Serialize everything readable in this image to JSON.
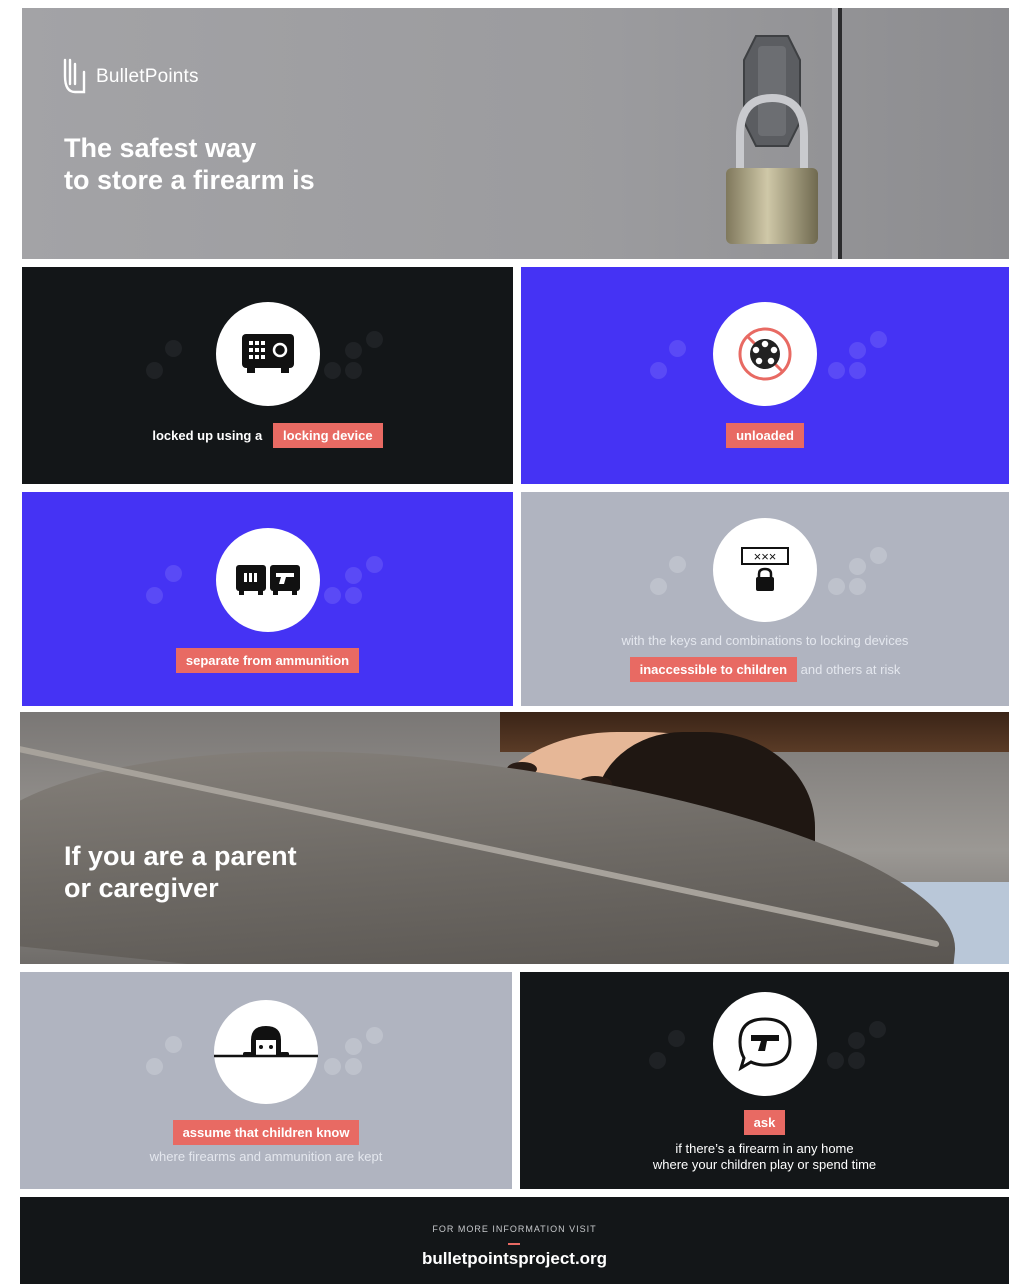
{
  "colors": {
    "coral": "#e86a63",
    "blue": "#4533f4",
    "dark": "#131618",
    "gray": "#b0b4c0",
    "hero_gray": "#9a9a9d"
  },
  "brand": {
    "name": "BulletPoints",
    "logo_icon": "hand-icon"
  },
  "hero": {
    "line1": "The safest way",
    "line2": "to store a firearm is"
  },
  "cards": {
    "locked": {
      "icon": "safe-icon",
      "text": "locked up using a",
      "tag": "locking device"
    },
    "unloaded": {
      "icon": "empty-cylinder-icon",
      "tag": "unloaded"
    },
    "separate": {
      "icon": "separate-safes-icon",
      "tag": "separate from ammunition"
    },
    "inaccessible": {
      "icon": "password-lock-icon",
      "line1": "with the keys and combinations to locking devices",
      "tag": "inaccessible to children",
      "after": "and others at risk"
    }
  },
  "parent": {
    "line1": "If you are a parent",
    "line2": "or caregiver"
  },
  "cards2": {
    "assume": {
      "icon": "peeking-child-icon",
      "tag": "assume that children know",
      "line": "where firearms and ammunition are kept"
    },
    "ask": {
      "icon": "speech-bubble-gun-icon",
      "tag": "ask",
      "line1": "if there’s a firearm in any home",
      "line2": "where your children play or spend time"
    }
  },
  "footer": {
    "small": "FOR MORE INFORMATION VISIT",
    "url": "bulletpointsproject.org"
  }
}
